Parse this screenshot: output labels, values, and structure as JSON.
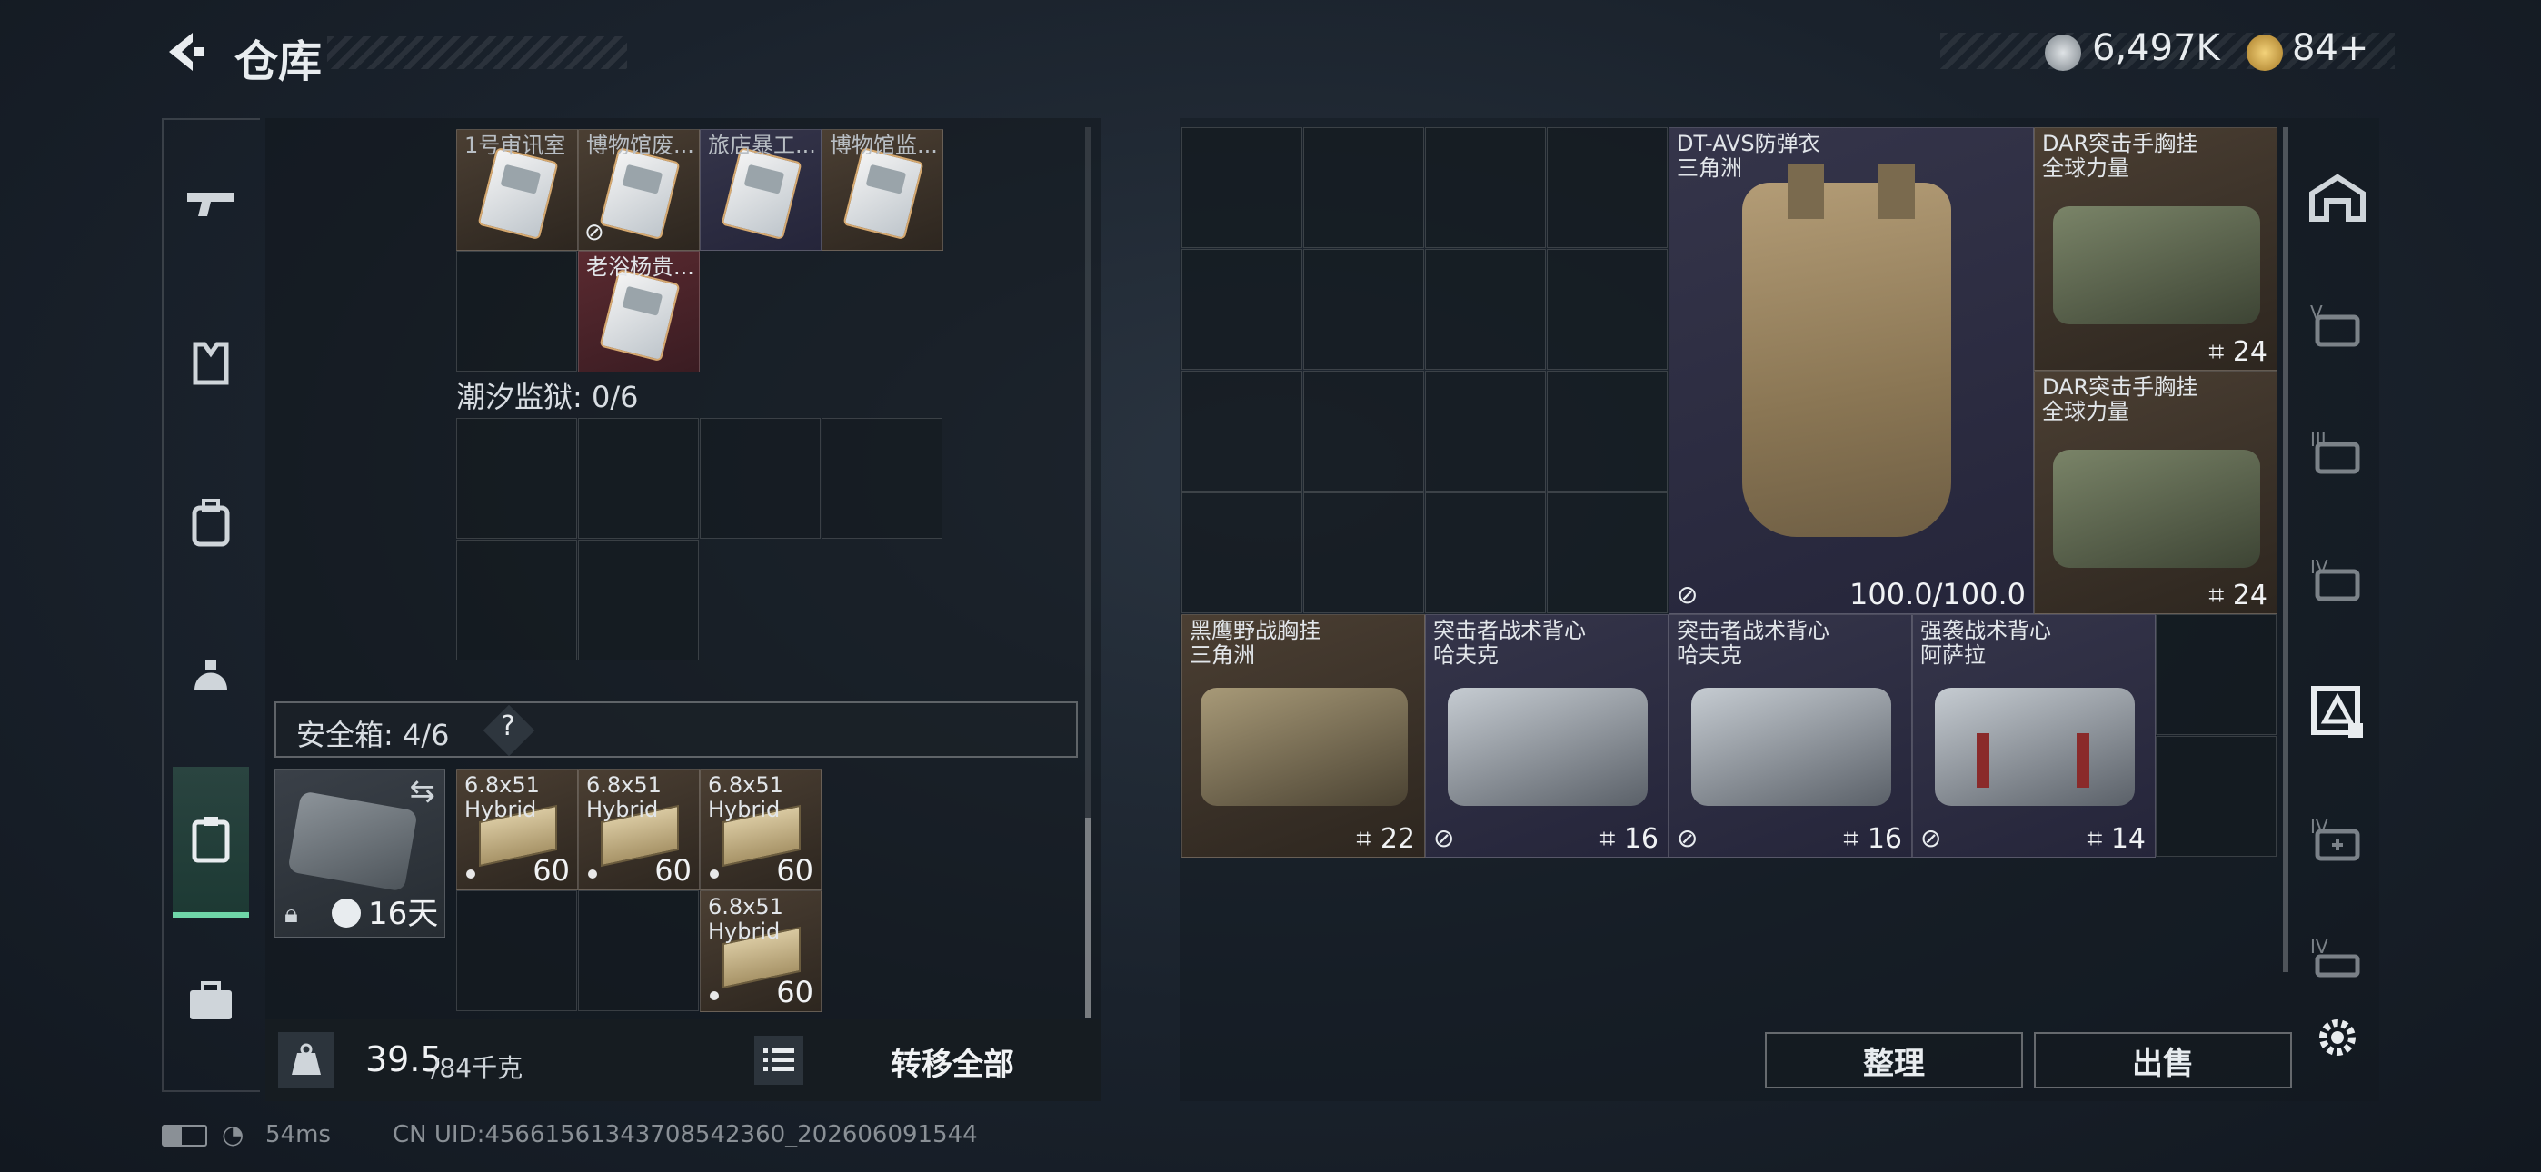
{
  "header": {
    "title": "仓库",
    "currency1": "6,497K",
    "currency2": "84+"
  },
  "left": {
    "row1_items": [
      "1号审讯室",
      "博物馆废...",
      "旅店暴工...",
      "博物馆监..."
    ],
    "row2_item": "老浴杨贵...",
    "zone_label": "潮汐监狱: 0/6",
    "safebox_label": "安全箱: 4/6",
    "safebox_help": "?",
    "safebox_time": "16天",
    "ammo": [
      {
        "name": "6.8x51",
        "sub": "Hybrid",
        "count": "60"
      },
      {
        "name": "6.8x51",
        "sub": "Hybrid",
        "count": "60"
      },
      {
        "name": "6.8x51",
        "sub": "Hybrid",
        "count": "60"
      },
      {
        "name": "6.8x51",
        "sub": "Hybrid",
        "count": "60"
      }
    ],
    "weight_value": "39.5",
    "weight_unit": "/84千克",
    "transfer_all": "转移全部"
  },
  "right": {
    "armor": {
      "name": "DT-AVS防弹衣",
      "maker": "三角洲",
      "durability": "100.0/100.0"
    },
    "rigs": [
      {
        "name": "DAR突击手胸挂",
        "maker": "全球力量",
        "slots": "24"
      },
      {
        "name": "DAR突击手胸挂",
        "maker": "全球力量",
        "slots": "24"
      }
    ],
    "bottom": [
      {
        "name": "黑鹰野战胸挂",
        "maker": "三角洲",
        "slots": "22"
      },
      {
        "name": "突击者战术背心",
        "maker": "哈夫克",
        "slots": "16"
      },
      {
        "name": "突击者战术背心",
        "maker": "哈夫克",
        "slots": "16"
      },
      {
        "name": "强袭战术背心",
        "maker": "阿萨拉",
        "slots": "14"
      }
    ],
    "sort_button": "整理",
    "sell_button": "出售"
  },
  "status": {
    "ping": "54ms",
    "uid": "CN UID:4566156134370854236​0_202606091544"
  },
  "colors": {
    "accent": "#6fd6a8",
    "brown": "#4b3f33",
    "blue": "#35354a",
    "red": "#5a2a30"
  }
}
